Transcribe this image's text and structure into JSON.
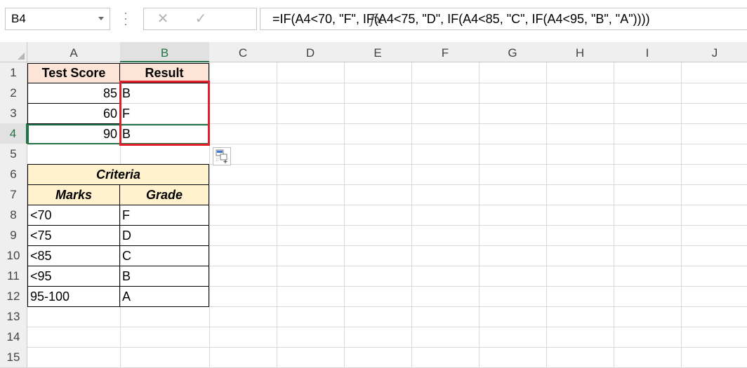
{
  "name_box": {
    "value": "B4"
  },
  "formula_bar": {
    "cancel_icon": "✕",
    "enter_icon": "✓",
    "fx_label": "fx",
    "formula": "=IF(A4<70, \"F\", IF(A4<75, \"D\", IF(A4<85, \"C\", IF(A4<95, \"B\", \"A\"))))"
  },
  "columns": [
    "A",
    "B",
    "C",
    "D",
    "E",
    "F",
    "G",
    "H",
    "I",
    "J"
  ],
  "rows": [
    "1",
    "2",
    "3",
    "4",
    "5",
    "6",
    "7",
    "8",
    "9",
    "10",
    "11",
    "12",
    "13",
    "14",
    "15"
  ],
  "active_cell": {
    "column": "B",
    "row": "4"
  },
  "cells": {
    "A1": "Test Score",
    "B1": "Result",
    "A2": "85",
    "B2": "B",
    "A3": "60",
    "B3": "F",
    "A4": "90",
    "B4": "B",
    "A6": "Criteria",
    "A7": "Marks",
    "B7": "Grade",
    "A8": "<70",
    "B8": "F",
    "A9": "<75",
    "B9": "D",
    "A10": "<85",
    "B10": "C",
    "A11": "<95",
    "B11": "B",
    "A12": "95-100",
    "B12": "A"
  },
  "colors": {
    "accent": "#217346",
    "highlight_box": "#e0202a",
    "header_orange": "#fce4d6",
    "header_yellow": "#fff2cc"
  },
  "icons": {
    "paste_options": "paste-options-icon"
  }
}
